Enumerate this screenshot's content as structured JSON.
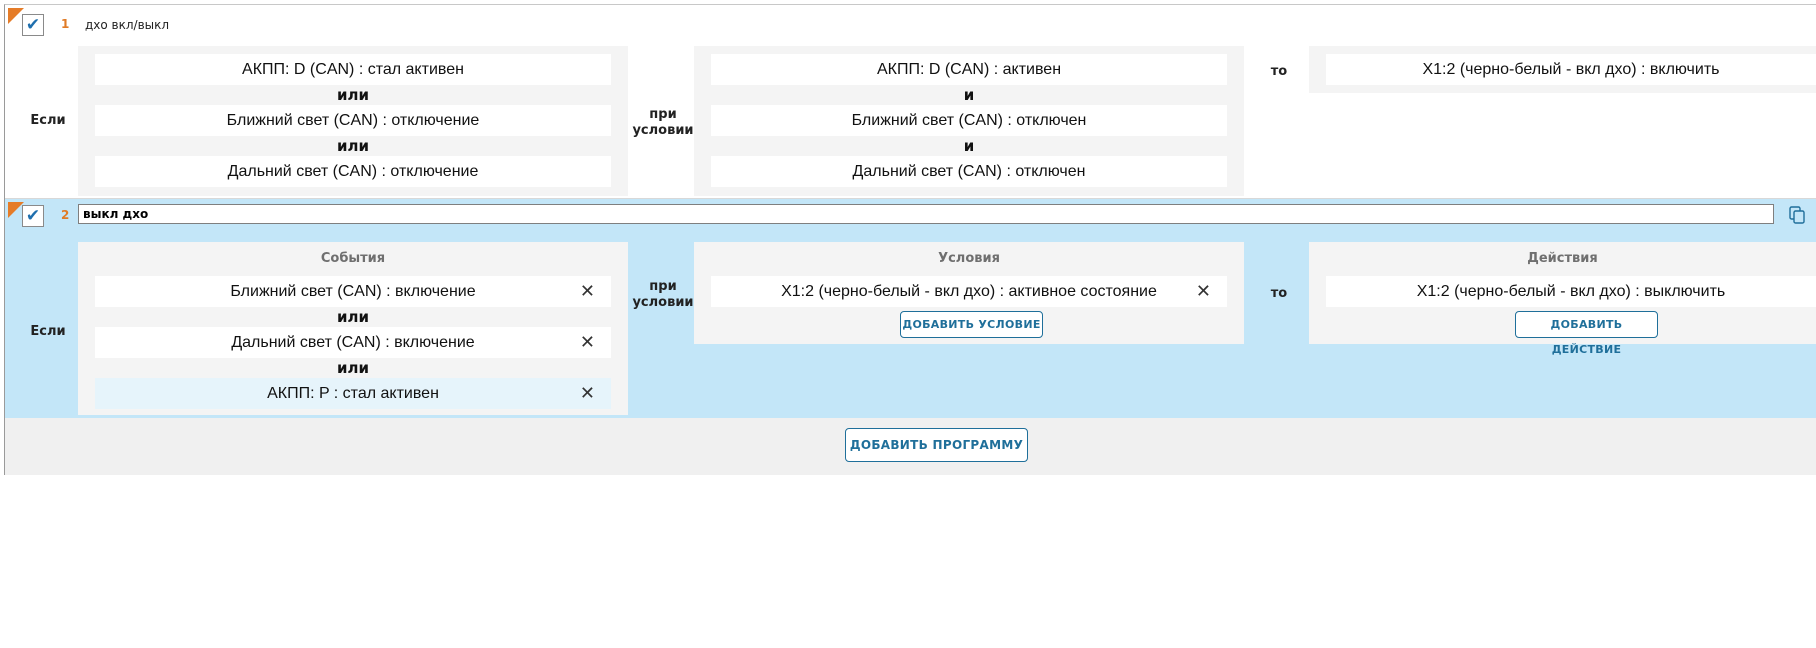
{
  "programs": [
    {
      "number": "1",
      "name": "дхо вкл/выкл",
      "if_label": "Если",
      "condition_label": "при условии",
      "then_label": "то",
      "events": [
        "АКПП: D (CAN) : стал активен",
        "Ближний свет (CAN) : отключение",
        "Дальний свет (CAN) : отключение"
      ],
      "event_conjunction": "или",
      "conditions": [
        "АКПП: D (CAN) : активен",
        "Ближний свет (CAN) : отключен",
        "Дальний свет (CAN) : отключен"
      ],
      "condition_conjunction": "и",
      "actions": [
        "X1:2 (черно-белый - вкл дхо) : включить"
      ]
    },
    {
      "number": "2",
      "name": "выкл дхо",
      "if_label": "Если",
      "condition_label": "при условии",
      "then_label": "то",
      "events_title": "События",
      "conditions_title": "Условия",
      "actions_title": "Действия",
      "events": [
        "Ближний свет (CAN) : включение",
        "Дальний свет (CAN) : включение",
        "АКПП: P : стал активен"
      ],
      "event_conjunction": "или",
      "conditions": [
        "X1:2 (черно-белый - вкл дхо) : активное состояние"
      ],
      "actions": [
        "X1:2 (черно-белый - вкл дхо) : выключить"
      ],
      "add_condition_label": "ДОБАВИТЬ УСЛОВИЕ",
      "add_action_label": "ДОБАВИТЬ ДЕЙСТВИЕ",
      "remove_symbol": "✕"
    }
  ],
  "add_program_label": "ДОБАВИТЬ ПРОГРАММУ",
  "check_symbol": "✔",
  "colors": {
    "accent": "#1f6f9a",
    "selected_bg": "#c3e6f8",
    "number": "#e07b26"
  }
}
